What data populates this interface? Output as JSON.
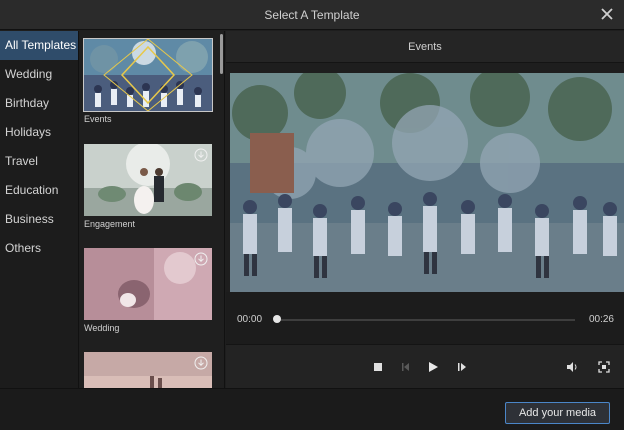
{
  "window": {
    "title": "Select A Template"
  },
  "categories": [
    {
      "label": "All Templates",
      "active": true
    },
    {
      "label": "Wedding"
    },
    {
      "label": "Birthday"
    },
    {
      "label": "Holidays"
    },
    {
      "label": "Travel"
    },
    {
      "label": "Education"
    },
    {
      "label": "Business"
    },
    {
      "label": "Others"
    }
  ],
  "templates": [
    {
      "label": "Events",
      "selected": true,
      "downloadable": false
    },
    {
      "label": "Engagement",
      "downloadable": true
    },
    {
      "label": "Wedding",
      "downloadable": true
    },
    {
      "label": "",
      "downloadable": true
    }
  ],
  "preview": {
    "title": "Events",
    "current_time": "00:00",
    "duration": "00:26",
    "progress": 0
  },
  "footer": {
    "add_media_label": "Add your media"
  },
  "colors": {
    "accent": "#2f4c6a",
    "button_border": "#4b86c8"
  }
}
